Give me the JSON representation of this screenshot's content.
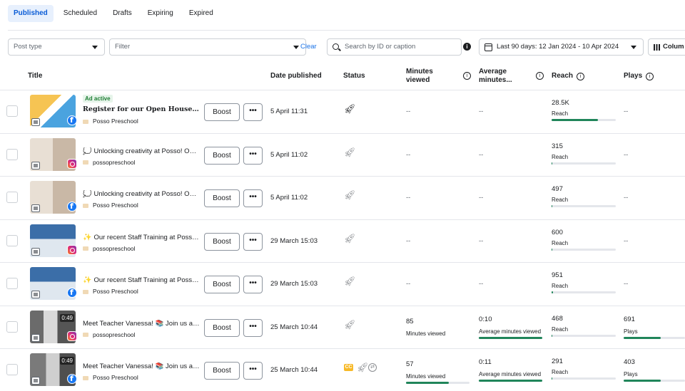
{
  "tabs": [
    "Published",
    "Scheduled",
    "Drafts",
    "Expiring",
    "Expired"
  ],
  "filters": {
    "post_type_placeholder": "Post type",
    "filter_placeholder": "Filter",
    "clear_label": "Clear",
    "search_placeholder": "Search by ID or caption",
    "date_range": "Last 90 days: 12 Jan 2024 - 10 Apr 2024",
    "columns_label": "Colum"
  },
  "columns": {
    "title": "Title",
    "date": "Date published",
    "status": "Status",
    "minutes_viewed": "Minutes viewed",
    "avg_minutes": "Average minutes...",
    "reach": "Reach",
    "plays": "Plays"
  },
  "labels": {
    "boost": "Boost",
    "more": "•••",
    "reach": "Reach",
    "plays": "Plays",
    "minutes_viewed": "Minutes viewed",
    "avg_minutes_viewed": "Average minutes viewed",
    "dash": "--"
  },
  "rows": [
    {
      "badge": "Ad active",
      "emoji": "",
      "caption": "Register for our Open House on th...",
      "page": "Posso Preschool",
      "platform": "facebook",
      "date": "5 April 11:31",
      "status": "rocket-dark",
      "minutes_viewed": "--",
      "avg_minutes": "--",
      "reach": "28.5K",
      "reach_fill": 0.72,
      "plays": "--",
      "video": ""
    },
    {
      "badge": "",
      "emoji": "💭",
      "caption": "Unlocking creativity at Posso! Our...",
      "page": "possopreschool",
      "platform": "instagram",
      "date": "5 April 11:02",
      "status": "rocket",
      "minutes_viewed": "--",
      "avg_minutes": "--",
      "reach": "315",
      "reach_fill": 0.01,
      "plays": "--",
      "video": ""
    },
    {
      "badge": "",
      "emoji": "💭",
      "caption": "Unlocking creativity at Posso! Our...",
      "page": "Posso Preschool",
      "platform": "facebook",
      "date": "5 April 11:02",
      "status": "rocket",
      "minutes_viewed": "--",
      "avg_minutes": "--",
      "reach": "497",
      "reach_fill": 0.015,
      "plays": "--",
      "video": ""
    },
    {
      "badge": "",
      "emoji": "✨",
      "caption": "Our recent Staff Training at Posso ...",
      "page": "possopreschool",
      "platform": "instagram",
      "date": "29 March 15:03",
      "status": "rocket",
      "minutes_viewed": "--",
      "avg_minutes": "--",
      "reach": "600",
      "reach_fill": 0.015,
      "plays": "--",
      "video": ""
    },
    {
      "badge": "",
      "emoji": "✨",
      "caption": "Our recent Staff Training at Posso ...",
      "page": "Posso Preschool",
      "platform": "facebook",
      "date": "29 March 15:03",
      "status": "rocket",
      "minutes_viewed": "--",
      "avg_minutes": "--",
      "reach": "951",
      "reach_fill": 0.02,
      "plays": "--",
      "video": ""
    },
    {
      "badge": "",
      "emoji": "",
      "caption": "Meet Teacher Vanessa! 📚 Join us as ...",
      "page": "possopreschool",
      "platform": "instagram",
      "date": "25 March 10:44",
      "status": "rocket",
      "minutes_viewed": "85",
      "avg_minutes": "0:10",
      "avg_fill": 1.0,
      "reach": "468",
      "reach_fill": 0.015,
      "plays": "691",
      "plays_fill": 0.6,
      "video": "0:49"
    },
    {
      "badge": "",
      "emoji": "",
      "caption": "Meet Teacher Vanessa! 📚 Join us as ...",
      "page": "Posso Preschool",
      "platform": "facebook",
      "date": "25 March 10:44",
      "status": "cc-rocket-share",
      "minutes_viewed": "57",
      "minutes_fill": 0.67,
      "avg_minutes": "0:11",
      "avg_fill": 1.0,
      "reach": "291",
      "reach_fill": 0.01,
      "plays": "403",
      "plays_fill": 0.6,
      "video": "0:49"
    }
  ],
  "colors": {
    "accent": "#0a5cd6",
    "bar": "#20855a",
    "facebook": "#1877f2"
  }
}
